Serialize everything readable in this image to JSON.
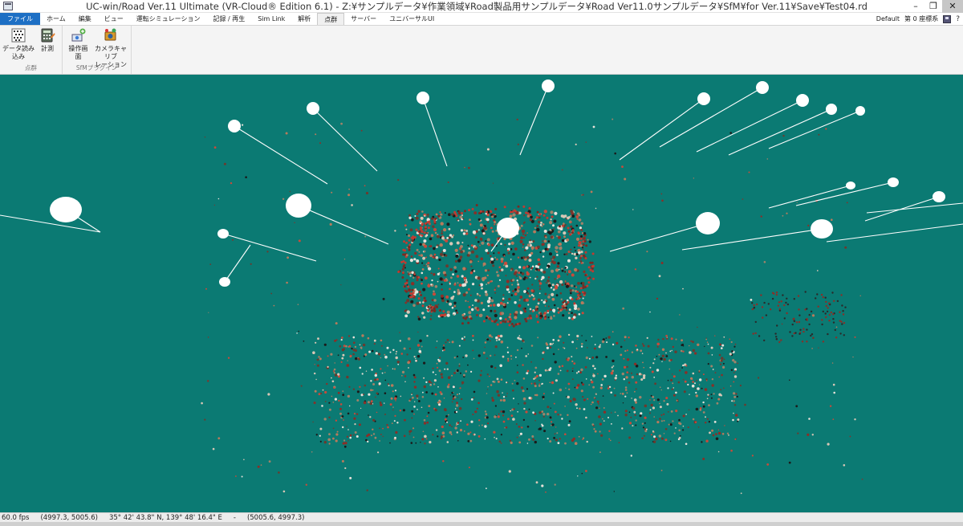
{
  "window": {
    "title": "UC-win/Road Ver.11 Ultimate (VR-Cloud® Edition 6.1) - Z:¥サンプルデータ¥作業領域¥Road製品用サンプルデータ¥Road Ver11.0サンプルデータ¥SfM¥for Ver.11¥Save¥Test04.rd",
    "controls": {
      "minimize": "–",
      "restore": "❐",
      "close": "✕"
    }
  },
  "tabs": [
    "ファイル",
    "ホーム",
    "編集",
    "ビュー",
    "運転シミュレーション",
    "記録 / 再生",
    "Sim Link",
    "解析",
    "点群",
    "サーバー",
    "ユニバーサルUI"
  ],
  "active_tab": "点群",
  "tabrow_right": {
    "profile": "Default",
    "coord": "第 0 座標系"
  },
  "ribbon": {
    "groups": [
      {
        "caption": "点群",
        "buttons": [
          {
            "label": "データ読み\n込み",
            "icon": "point-data-icon"
          },
          {
            "label": "計測",
            "icon": "calculator-icon"
          }
        ]
      },
      {
        "caption": "SfMプラグイン",
        "buttons": [
          {
            "label": "操作画面",
            "icon": "operation-icon"
          },
          {
            "label": "カメラキャリブ\nレーション",
            "icon": "camera-calibration-icon"
          }
        ]
      }
    ]
  },
  "status": {
    "fps": "60.0 fps",
    "coords": "(4997.3, 5005.6)",
    "latlon": "35° 42' 43.8\" N, 139° 48' 16.4\" E",
    "view_coords": "(5005.6, 4997.3)"
  },
  "colors": {
    "viewport_bg": "#0b7a73",
    "file_tab": "#1d6fc4"
  }
}
